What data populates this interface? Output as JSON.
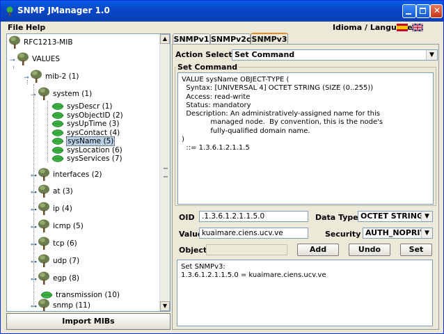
{
  "window": {
    "title": "SNMP JManager 1.0"
  },
  "menu": {
    "file": "File",
    "help": "Help",
    "language_label": "Idioma / Language"
  },
  "tree": {
    "root": "RFC1213-MIB",
    "values": "VALUES",
    "mib2": "mib-2 (1)",
    "system": "system (1)",
    "system_children": [
      "sysDescr (1)",
      "sysObjectID (2)",
      "sysUpTime (3)",
      "sysContact (4)",
      "sysName (5)",
      "sysLocation (6)",
      "sysServices (7)"
    ],
    "selected": "sysName (5)",
    "groups": [
      "interfaces (2)",
      "at (3)",
      "ip (4)",
      "icmp (5)",
      "tcp (6)",
      "udp (7)",
      "egp (8)",
      "transmission (10)",
      "snmp (11)"
    ]
  },
  "import_button": "Import MIBs",
  "tabs": [
    "SNMPv1",
    "SNMPv2c",
    "SNMPv3"
  ],
  "active_tab": "SNMPv3",
  "action": {
    "label": "Action Selected",
    "value": "Set Command"
  },
  "command_group": {
    "title": "Set Command",
    "text": "VALUE sysName OBJECT-TYPE (\n  Syntax: [UNIVERSAL 4] OCTET STRING (SIZE (0..255))\n  Access: read-write\n  Status: mandatory\n  Description: An administratively-assigned name for this\n             managed node.  By convention, this is the node's\n             fully-qualified domain name.\n)\n  ::= 1.3.6.1.2.1.1.5"
  },
  "form": {
    "oid_label": "OID",
    "oid_value": ".1.3.6.1.2.1.1.5.0",
    "datatype_label": "Data Type",
    "datatype_value": "OCTET STRING",
    "value_label": "Value",
    "value_value": "kuaimare.ciens.ucv.ve",
    "security_label": "Security",
    "security_value": "AUTH_NOPRIV",
    "objects_label": "Objects",
    "objects_value": ""
  },
  "buttons": {
    "add": "Add",
    "undo": "Undo",
    "set": "Set"
  },
  "output": "Set SNMPv3:\n1.3.6.1.2.1.1.5.0 = kuaimare.ciens.ucv.ve",
  "colors": {
    "titlebar": "#0a4fd0",
    "tree_leaf": "#3cb043",
    "selection": "#b8cfe5",
    "active_tab": "#e68b2c"
  }
}
